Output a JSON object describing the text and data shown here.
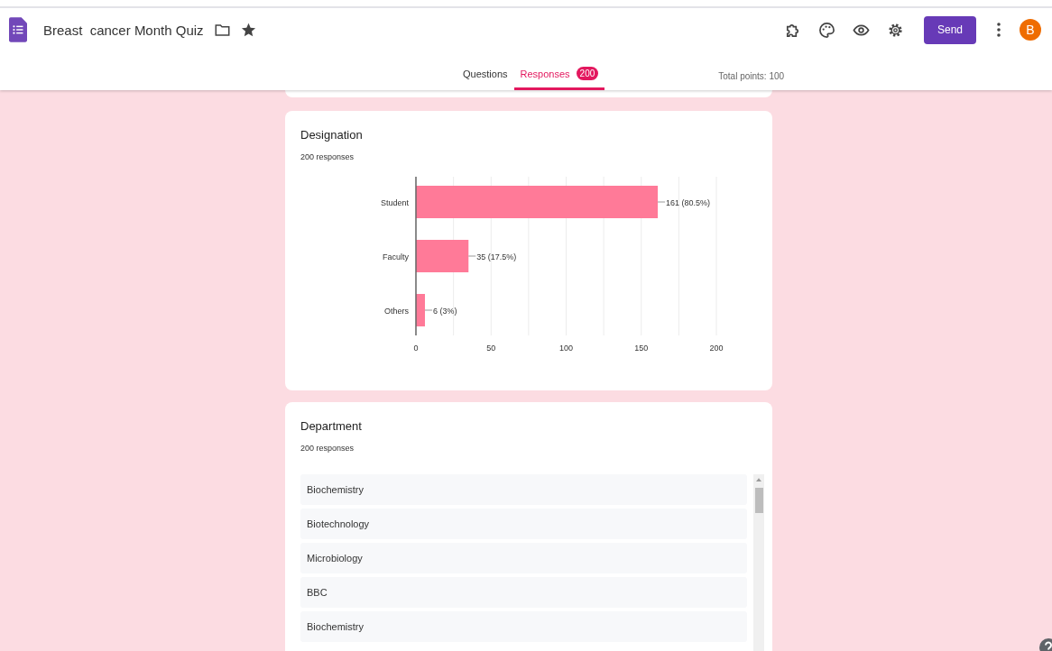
{
  "header": {
    "title": "Breast  cancer Month Quiz",
    "send_button": "Send",
    "avatar": "B"
  },
  "tabs": [
    {
      "label": "Questions",
      "selected": false
    },
    {
      "label": "Responses",
      "selected": true,
      "badge": "200"
    }
  ],
  "total_points": "Total points: 100",
  "designation": {
    "title": "Designation",
    "count": "200 responses",
    "chart_data": {
      "type": "bar",
      "orientation": "horizontal",
      "categories": [
        "Student",
        "Faculty",
        "Others"
      ],
      "values": [
        161,
        35,
        6
      ],
      "grid": true,
      "xlim": [
        0,
        200
      ],
      "xticks": [
        0,
        50,
        100,
        150,
        200
      ],
      "value_labels": [
        "161 (80.5%)",
        "35 (17.5%)",
        "6 (3%)"
      ]
    }
  },
  "department": {
    "title": "Department",
    "count": "200 responses",
    "answers": [
      "Biochemistry",
      "Biotechnology",
      "Microbiology",
      "BBC",
      "Biochemistry"
    ]
  }
}
